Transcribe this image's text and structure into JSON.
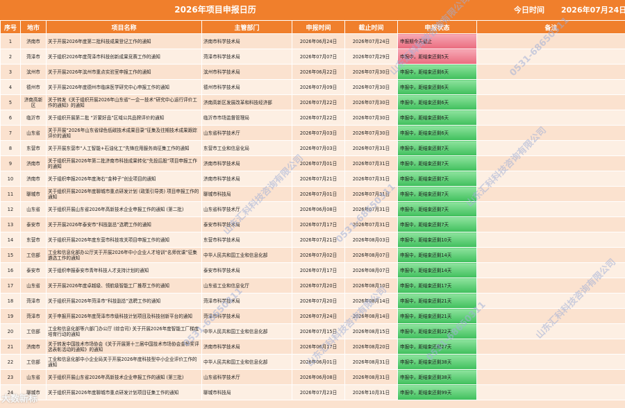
{
  "header": {
    "title": "2026年项目申报日历",
    "today_label": "今日时间",
    "today_value": "2026年07月24日"
  },
  "columns": [
    "序号",
    "地市",
    "项目名称",
    "主管部门",
    "申报时间",
    "截止时间",
    "申报状态",
    "备注"
  ],
  "rows": [
    {
      "no": "1",
      "city": "济南市",
      "name": "关于开展2026年度第二批科技成果登记工作的通知",
      "dept": "济南市科学技术局",
      "start": "2026年06月24日",
      "end": "2026年07月24日",
      "status": "申报期今天截止",
      "state": "red"
    },
    {
      "no": "2",
      "city": "菏泽市",
      "name": "关于组织2026年度菏泽市科技创新成果竞赛工作的通知",
      "dept": "菏泽市科学技术局",
      "start": "2026年07月07日",
      "end": "2026年07月29日",
      "status": "申报中，距结束还剩5天",
      "state": "red"
    },
    {
      "no": "3",
      "city": "滨州市",
      "name": "关于开展2026年滨州市重点实验室申报工作的通知",
      "dept": "滨州市科学技术局",
      "start": "2026年06月22日",
      "end": "2026年07月30日",
      "status": "申报中，距结束还剩6天",
      "state": "green"
    },
    {
      "no": "4",
      "city": "德州市",
      "name": "关于开展2026年度德州市临床医学研究中心申报工作的通知",
      "dept": "德州市科学技术局",
      "start": "2026年07月09日",
      "end": "2026年07月30日",
      "status": "申报中，距结束还剩6天",
      "state": "green"
    },
    {
      "no": "5",
      "city": "济南高新区",
      "name": "关于转发《关于组织开展2026年山东省“一企一技术”研究中心运行评价工作的通知》的通知",
      "dept": "济南高新区发展改革和科技经济部",
      "start": "2026年07月22日",
      "end": "2026年07月30日",
      "status": "申报中，距结束还剩6天",
      "state": "green"
    },
    {
      "no": "6",
      "city": "临沂市",
      "name": "关于组织开展第二批 “沂蒙好品”区域公共品牌评价的通知",
      "dept": "临沂市市场监督管理局",
      "start": "2026年07月22日",
      "end": "2026年07月30日",
      "status": "申报中，距结束还剩6天",
      "state": "green"
    },
    {
      "no": "7",
      "city": "山东省",
      "name": "关于开展“2026年山东省绿色低碳技术成果目录”征集及往期技术成果跟踪评价的通知",
      "dept": "山东省科学技术厅",
      "start": "2026年07月03日",
      "end": "2026年07月30日",
      "status": "申报中，距结束还剩6天",
      "state": "green"
    },
    {
      "no": "8",
      "city": "东营市",
      "name": "关于开展东营市“人工智能+石油化工”先锋应用服务商征集工作的通知",
      "dept": "东营市工业和信息化局",
      "start": "2026年07月03日",
      "end": "2026年07月31日",
      "status": "申报中，距结束还剩7天",
      "state": "green"
    },
    {
      "no": "9",
      "city": "济南市",
      "name": "关于组织开展2026年第二批济南市科技成果转化“先投后股”项目申报工作的通知",
      "dept": "济南市科学技术局",
      "start": "2026年07月01日",
      "end": "2026年07月31日",
      "status": "申报中，距结束还剩7天",
      "state": "green"
    },
    {
      "no": "10",
      "city": "济南市",
      "name": "关于组织申报2026年度海右“金种子”创业项目的通知",
      "dept": "济南市科学技术局",
      "start": "2026年07月21日",
      "end": "2026年07月31日",
      "status": "申报中，距结束还剩7天",
      "state": "green"
    },
    {
      "no": "11",
      "city": "聊城市",
      "name": "关于组织开展2026年度聊城市重点研发计划 (政策引导类) 项目申报工作的通知",
      "dept": "聊城市科技局",
      "start": "2026年07月01日",
      "end": "2026年07月31日",
      "status": "申报中，距结束还剩7天",
      "state": "green"
    },
    {
      "no": "12",
      "city": "山东省",
      "name": "关于组织开展山东省2026年高新技术企业申报工作的通知 (第二批)",
      "dept": "山东省科学技术厅",
      "start": "2026年06月08日",
      "end": "2026年07月31日",
      "status": "申报中，距结束还剩7天",
      "state": "green"
    },
    {
      "no": "13",
      "city": "泰安市",
      "name": "关于开展2026年泰安市“科技副总”选聘工作的通知",
      "dept": "泰安市科学技术局",
      "start": "2026年07月17日",
      "end": "2026年07月31日",
      "status": "申报中，距结束还剩7天",
      "state": "green"
    },
    {
      "no": "14",
      "city": "东营市",
      "name": "关于组织开展2026年度东营市科技攻关项目申报工作的通知",
      "dept": "东营市科学技术局",
      "start": "2026年07月21日",
      "end": "2026年08月03日",
      "status": "申报中，距结束还剩10天",
      "state": "green"
    },
    {
      "no": "15",
      "city": "工信部",
      "name": "工业和信息化部办公厅关于开展2026年中小企业人才培训“名师优课”征集遴选工作的通知",
      "dept": "中华人民共和国工业和信息化部",
      "start": "2026年07月02日",
      "end": "2026年08月07日",
      "status": "申报中，距结束还剩14天",
      "state": "green"
    },
    {
      "no": "16",
      "city": "泰安市",
      "name": "关于组织申报泰安市青年科技人才支持计划的通知",
      "dept": "泰安市科学技术局",
      "start": "2026年07月17日",
      "end": "2026年08月07日",
      "status": "申报中，距结束还剩14天",
      "state": "green"
    },
    {
      "no": "17",
      "city": "山东省",
      "name": "关于开展2026年度卓越级、领航级智能工厂推荐工作的通知",
      "dept": "山东省工业和信息化厅",
      "start": "2026年07月20日",
      "end": "2026年08月10日",
      "status": "申报中，距结束还剩17天",
      "state": "green"
    },
    {
      "no": "18",
      "city": "菏泽市",
      "name": "关于组织开展2026年菏泽市“科技副总”选聘工作的通知",
      "dept": "菏泽市科学技术局",
      "start": "2026年07月20日",
      "end": "2026年08月14日",
      "status": "申报中，距结束还剩21天",
      "state": "green"
    },
    {
      "no": "19",
      "city": "菏泽市",
      "name": "关于申报开展2026年度菏泽市市级科技计划项目及科技创新平台的通知",
      "dept": "菏泽市科学技术局",
      "start": "2026年07月24日",
      "end": "2026年08月14日",
      "status": "申报中，距结束还剩21天",
      "state": "green"
    },
    {
      "no": "20",
      "city": "工信部",
      "name": "工业和信息化部等六部门办公厅 (综合司) 关于开展2026年度智能工厂梯度培育行动的通知",
      "dept": "中华人民共和国工业和信息化部",
      "start": "2026年07月15日",
      "end": "2026年08月15日",
      "status": "申报中，距结束还剩22天",
      "state": "green"
    },
    {
      "no": "21",
      "city": "济南市",
      "name": "关于转发中国技术市场协会《关于开展第十三届中国技术市场协会金桥奖评选表彰活动的通知》的通知",
      "dept": "济南市科学技术局",
      "start": "2026年06月17日",
      "end": "2026年08月20日",
      "status": "申报中，距结束还剩27天",
      "state": "green"
    },
    {
      "no": "22",
      "city": "工信部",
      "name": "工业和信息化部中小企业局关于开展2026年度科技型中小企业评价工作的通知",
      "dept": "中华人民共和国工业和信息化部",
      "start": "2026年06月01日",
      "end": "2026年08月31日",
      "status": "申报中，距结束还剩38天",
      "state": "green"
    },
    {
      "no": "23",
      "city": "山东省",
      "name": "关于组织开展山东省2026年高新技术企业申报工作的通知 (第三批)",
      "dept": "山东省科学技术厅",
      "start": "2026年06月08日",
      "end": "2026年08月31日",
      "status": "申报中，距结束还剩38天",
      "state": "green"
    },
    {
      "no": "24",
      "city": "聊城市",
      "name": "关于组织开展2026年度聊城市重点研发计划项目征集工作的通知",
      "dept": "聊城市科技局",
      "start": "2026年07月23日",
      "end": "2026年10月31日",
      "status": "申报中，距结束还剩99天",
      "state": "green"
    }
  ],
  "watermark": {
    "company": "山东汇科科技咨询有限公司",
    "phone": "0531-68650311"
  },
  "logo_text": "大数新标"
}
